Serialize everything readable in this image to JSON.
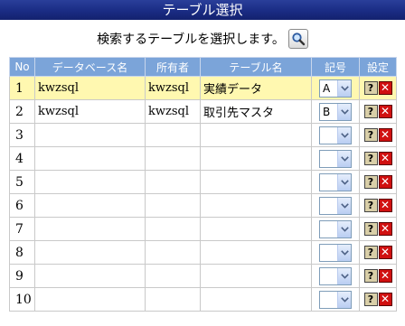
{
  "title": "テーブル選択",
  "instruction": "検索するテーブルを選択します。",
  "columns": {
    "no": "No",
    "database": "データベース名",
    "owner": "所有者",
    "table": "テーブル名",
    "symbol": "記号",
    "settings": "設定"
  },
  "rows": [
    {
      "no": "1",
      "database": "kwzsql",
      "owner": "kwzsql",
      "table": "実績データ",
      "symbol": "A"
    },
    {
      "no": "2",
      "database": "kwzsql",
      "owner": "kwzsql",
      "table": "取引先マスタ",
      "symbol": "B"
    },
    {
      "no": "3",
      "database": "",
      "owner": "",
      "table": "",
      "symbol": ""
    },
    {
      "no": "4",
      "database": "",
      "owner": "",
      "table": "",
      "symbol": ""
    },
    {
      "no": "5",
      "database": "",
      "owner": "",
      "table": "",
      "symbol": ""
    },
    {
      "no": "6",
      "database": "",
      "owner": "",
      "table": "",
      "symbol": ""
    },
    {
      "no": "7",
      "database": "",
      "owner": "",
      "table": "",
      "symbol": ""
    },
    {
      "no": "8",
      "database": "",
      "owner": "",
      "table": "",
      "symbol": ""
    },
    {
      "no": "9",
      "database": "",
      "owner": "",
      "table": "",
      "symbol": ""
    },
    {
      "no": "10",
      "database": "",
      "owner": "",
      "table": "",
      "symbol": ""
    }
  ],
  "icons": {
    "search": "search-icon",
    "help": "help-icon",
    "delete": "delete-icon",
    "dropdown": "chevron-down-icon"
  },
  "colors": {
    "title_bar": "#1a2c84",
    "header": "#7ba4d9",
    "selected_row": "#fff8b0",
    "delete": "#d01010"
  }
}
